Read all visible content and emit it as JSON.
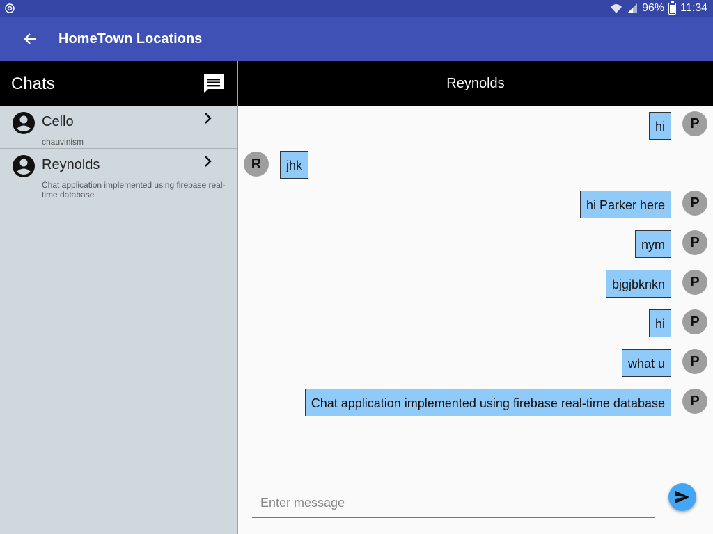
{
  "status_bar": {
    "battery": "96%",
    "time": "11:34"
  },
  "app_bar": {
    "title": "HomeTown Locations"
  },
  "chats_panel": {
    "title": "Chats",
    "items": [
      {
        "name": "Cello",
        "preview": "chauvinism"
      },
      {
        "name": "Reynolds",
        "preview": "Chat application implemented using firebase real-time database"
      }
    ]
  },
  "conversation": {
    "title": "Reynolds",
    "messages": [
      {
        "side": "right",
        "text": "hi",
        "avatar": "P"
      },
      {
        "side": "left",
        "text": "jhk",
        "avatar": "R"
      },
      {
        "side": "right",
        "text": "hi Parker here",
        "avatar": "P"
      },
      {
        "side": "right",
        "text": "nym",
        "avatar": "P"
      },
      {
        "side": "right",
        "text": "bjgjbknkn",
        "avatar": "P"
      },
      {
        "side": "right",
        "text": "hi",
        "avatar": "P"
      },
      {
        "side": "right",
        "text": "what u",
        "avatar": "P"
      },
      {
        "side": "right",
        "text": "Chat application implemented using firebase real-time database",
        "avatar": "P"
      }
    ],
    "input": {
      "value": "",
      "placeholder": "Enter message"
    }
  },
  "colors": {
    "app_bar": "#3f51b5",
    "status_bar": "#3646a6",
    "bubble": "#90caf9",
    "send_button": "#42a5f5"
  }
}
